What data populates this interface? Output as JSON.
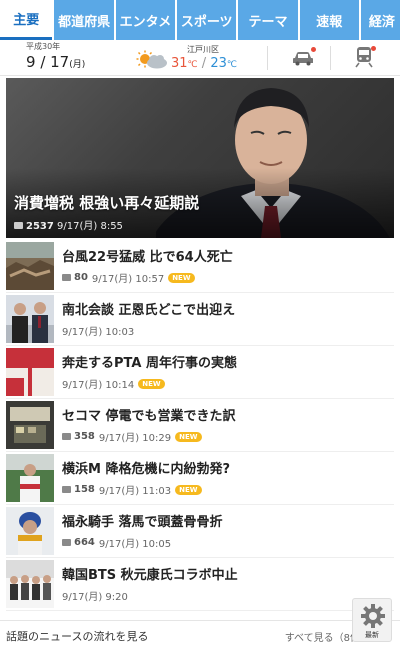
{
  "tabs": [
    "主要",
    "都道府県",
    "エンタメ",
    "スポーツ",
    "テーマ",
    "速報",
    "経済"
  ],
  "header": {
    "era": "平成30年",
    "month": "9",
    "day": "17",
    "weekday": "(月)",
    "area": "江戸川区",
    "temp_high": "31",
    "temp_low": "23",
    "temp_unit": "℃"
  },
  "hero": {
    "title": "消費増税 根強い再々延期説",
    "comments": "2537",
    "time": "9/17(月) 8:55"
  },
  "news": [
    {
      "title": "台風22号猛威 比で64人死亡",
      "comments": "80",
      "time": "9/17(月) 10:57",
      "new": "NEW"
    },
    {
      "title": "南北会談 正恩氏どこで出迎え",
      "comments": "",
      "time": "9/17(月) 10:03",
      "new": ""
    },
    {
      "title": "奔走するPTA 周年行事の実態",
      "comments": "",
      "time": "9/17(月) 10:14",
      "new": "NEW"
    },
    {
      "title": "セコマ 停電でも営業できた訳",
      "comments": "358",
      "time": "9/17(月) 10:29",
      "new": "NEW"
    },
    {
      "title": "横浜M 降格危機に内紛勃発?",
      "comments": "158",
      "time": "9/17(月) 11:03",
      "new": "NEW"
    },
    {
      "title": "福永騎手 落馬で頭蓋骨骨折",
      "comments": "664",
      "time": "9/17(月) 10:05",
      "new": ""
    },
    {
      "title": "韓国BTS 秋元康氏コラボ中止",
      "comments": "",
      "time": "9/17(月) 9:20",
      "new": ""
    }
  ],
  "footer": {
    "flow_link": "話題のニュースの流れを見る",
    "all_link": "すべて見る（8件）",
    "fab_label": "最新"
  },
  "icons": {
    "weather": "sun-cloud-icon",
    "car": "car-icon",
    "train": "train-icon",
    "comment": "comment-bubble-icon",
    "fab": "gear-icon"
  },
  "colors": {
    "tab_bg": "#5aa8e6",
    "tab_active": "#1a6fc0",
    "temp_high": "#e8553a",
    "temp_low": "#2d8fd6",
    "new_badge": "#f6b91e",
    "alert_dot": "#e84a3a"
  }
}
